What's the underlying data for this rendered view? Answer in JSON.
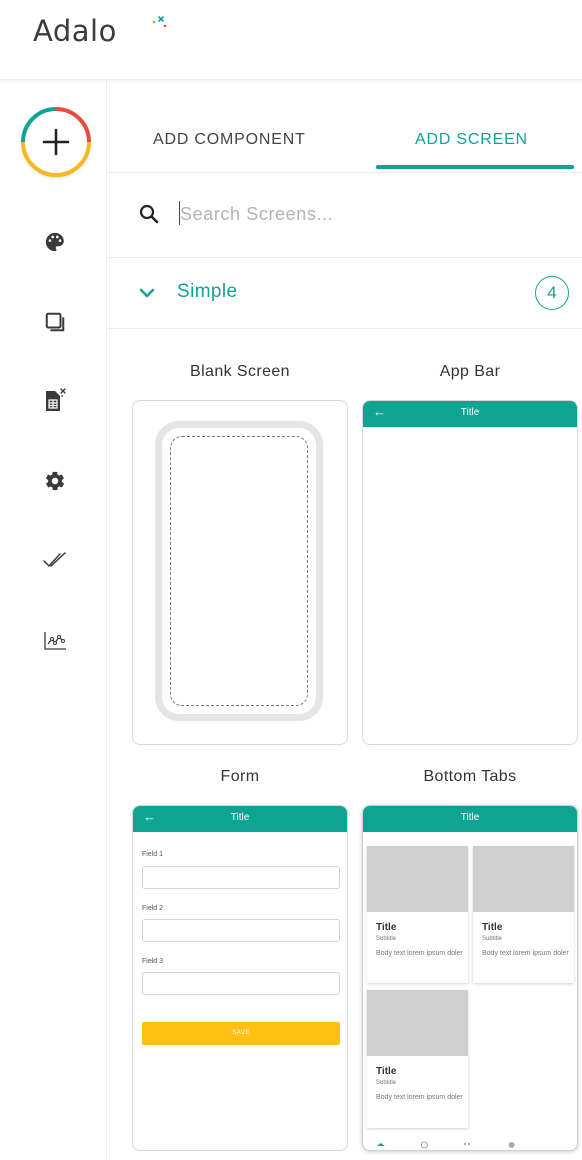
{
  "logo": {
    "text": "Adalo"
  },
  "rail": {
    "items": [
      {
        "icon": "palette-icon"
      },
      {
        "icon": "screens-icon"
      },
      {
        "icon": "database-icon"
      },
      {
        "icon": "gear-icon"
      },
      {
        "icon": "publish-check-icon"
      },
      {
        "icon": "analytics-icon"
      }
    ]
  },
  "tabs": {
    "add_component": "ADD COMPONENT",
    "add_screen": "ADD SCREEN"
  },
  "search": {
    "placeholder": "Search Screens...",
    "value": ""
  },
  "section": {
    "title": "Simple",
    "count": "4"
  },
  "cards": {
    "blank": {
      "label": "Blank Screen"
    },
    "app_bar": {
      "label": "App Bar",
      "bar_title": "Title"
    },
    "form": {
      "label": "Form",
      "bar_title": "Title",
      "field1": "Field 1",
      "field2": "Field 2",
      "field3": "Field 3",
      "save": "SAVE"
    },
    "bottom_tabs": {
      "label": "Bottom Tabs",
      "bar_title": "Title",
      "tiles": [
        {
          "title": "Title",
          "subtitle": "Subtitle",
          "body": "Body text lorem ipsum doler"
        },
        {
          "title": "Title",
          "subtitle": "Subtitle",
          "body": "Body text lorem ipsum doler"
        },
        {
          "title": "Title",
          "subtitle": "Subtitle",
          "body": "Body text lorem ipsum doler"
        }
      ]
    }
  },
  "colors": {
    "accent": "#0fa393",
    "save": "#ffc014",
    "placeholder": "#cfcfcf"
  }
}
